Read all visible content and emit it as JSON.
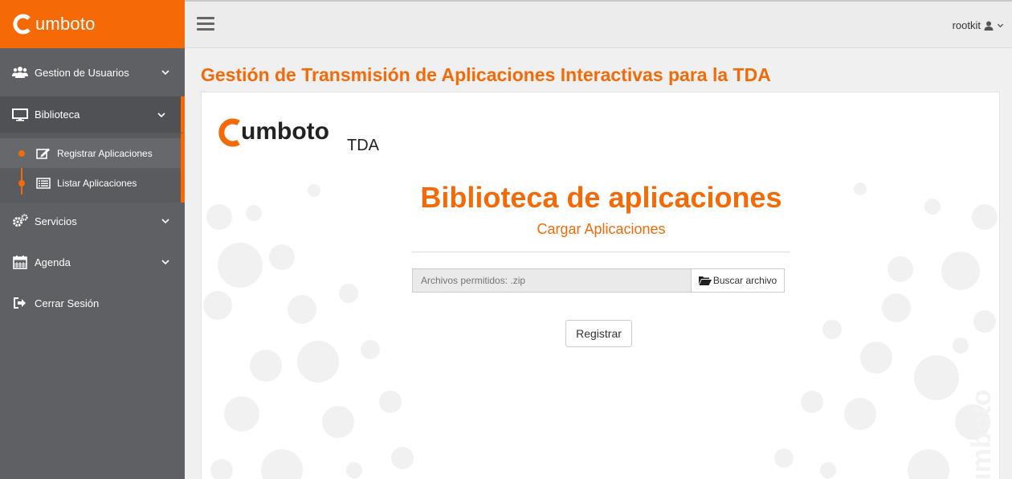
{
  "brand": {
    "name": "umboto",
    "accent": "#f56a07"
  },
  "sidebar": {
    "items": [
      {
        "label": "Gestion de Usuarios",
        "icon": "users-icon"
      },
      {
        "label": "Biblioteca",
        "icon": "desktop-icon"
      },
      {
        "label": "Servicios",
        "icon": "gears-icon"
      },
      {
        "label": "Agenda",
        "icon": "calendar-icon"
      },
      {
        "label": "Cerrar Sesión",
        "icon": "sign-out-icon"
      }
    ],
    "submenu": [
      {
        "label": "Registrar Aplicaciones",
        "icon": "edit-icon"
      },
      {
        "label": "Listar Aplicaciones",
        "icon": "list-icon"
      }
    ]
  },
  "topbar": {
    "user": "rootkit"
  },
  "page": {
    "title": "Gestión de Transmisión de Aplicaciones Interactivas para la TDA"
  },
  "panel": {
    "logo_text": "umboto",
    "logo_suffix": "TDA",
    "heading": "Biblioteca de aplicaciones",
    "subheading": "Cargar Aplicaciones",
    "file_placeholder": "Archivos permitidos: .zip",
    "browse_label": "Buscar archivo",
    "submit_label": "Registrar",
    "watermark": "umboto"
  }
}
